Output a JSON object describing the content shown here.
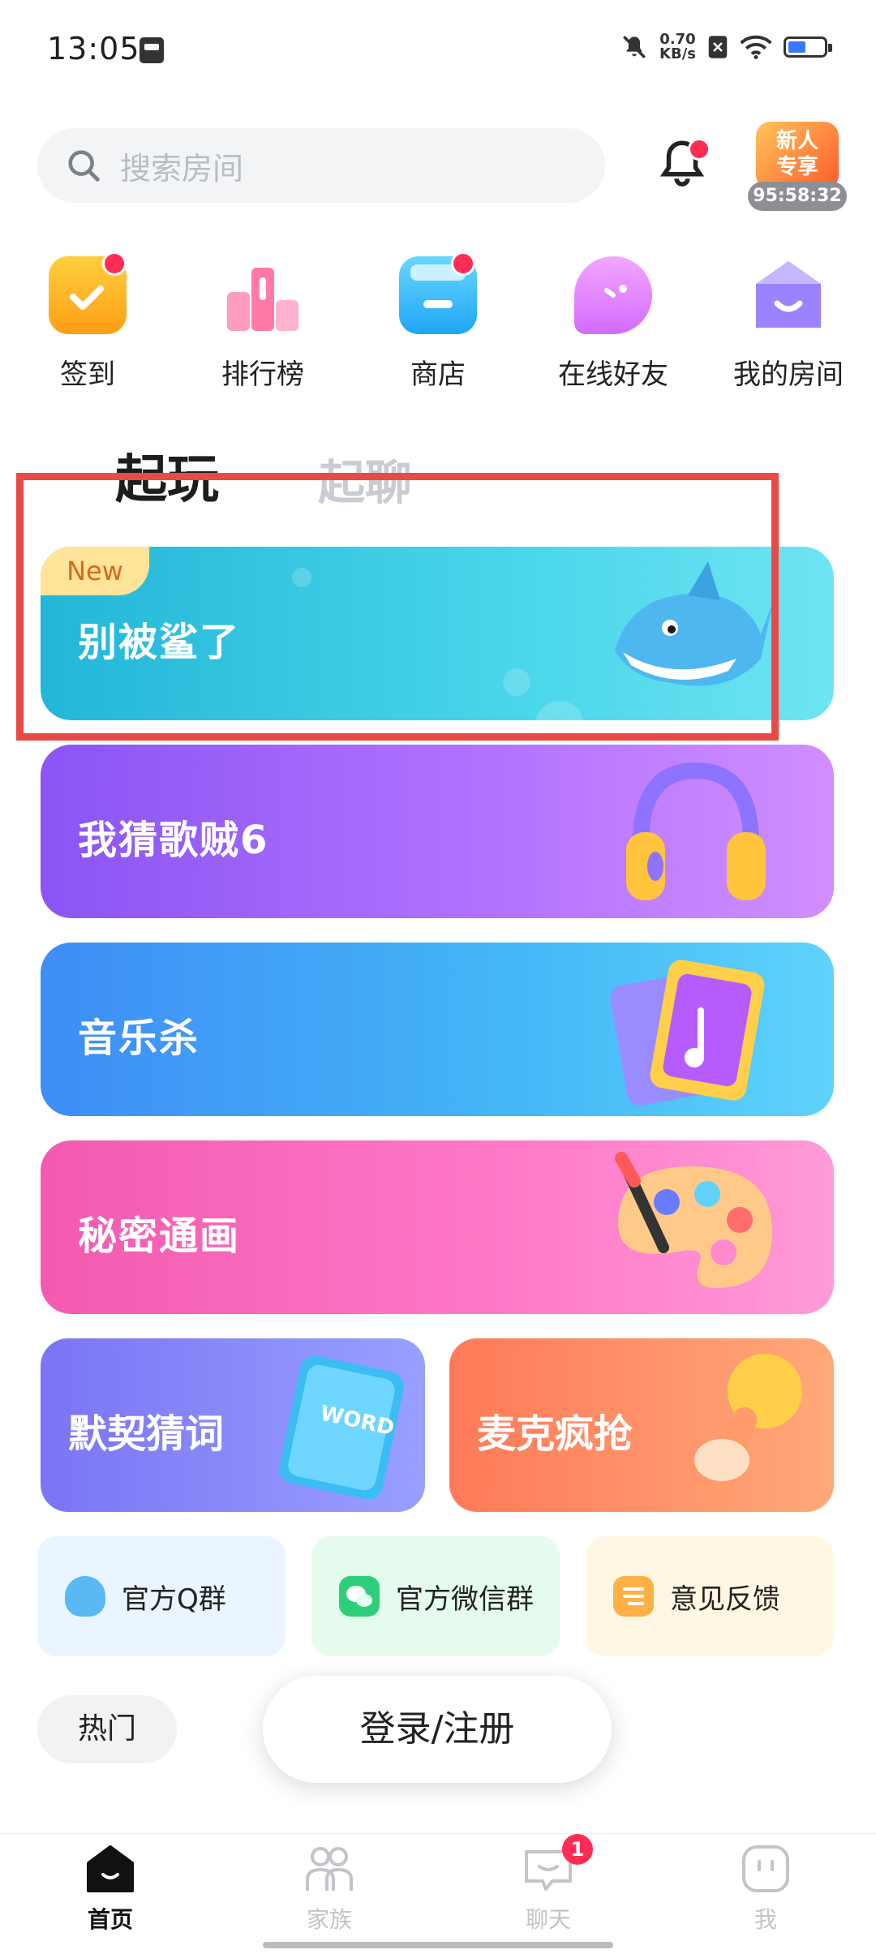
{
  "status": {
    "time": "13:05",
    "net_speed_value": "0.70",
    "net_speed_unit": "KB/s",
    "battery_level": 0.5
  },
  "search": {
    "placeholder": "搜索房间"
  },
  "promo": {
    "label_line1": "新人",
    "label_line2": "专享",
    "timer": "95:58:32"
  },
  "quick_entries": [
    {
      "label": "签到",
      "icon": "calendar-check-icon",
      "color": "#ffb21e",
      "badge": true
    },
    {
      "label": "排行榜",
      "icon": "podium-icon",
      "color": "#ff86b0",
      "badge": false
    },
    {
      "label": "商店",
      "icon": "shop-icon",
      "color": "#3cc4ff",
      "badge": true
    },
    {
      "label": "在线好友",
      "icon": "chat-bubble-icon",
      "color": "#e57bff",
      "badge": false
    },
    {
      "label": "我的房间",
      "icon": "house-icon",
      "color": "#8f74ff",
      "badge": false
    }
  ],
  "tabs": {
    "active": "起玩",
    "inactive": "起聊"
  },
  "games": {
    "shark": {
      "badge": "New",
      "title": "别被鲨了",
      "icon": "shark-icon"
    },
    "guess_song": {
      "title": "我猜歌贼6",
      "icon": "headphones-icon"
    },
    "music_kill": {
      "title": "音乐杀",
      "icon": "music-card-icon"
    },
    "secret_draw": {
      "title": "秘密通画",
      "icon": "palette-icon"
    },
    "guess_word": {
      "title": "默契猜词",
      "icon": "word-book-icon",
      "book_text": "WORD"
    },
    "mic_grab": {
      "title": "麦克疯抢",
      "icon": "microphone-icon"
    }
  },
  "channels": [
    {
      "label": "官方Q群",
      "icon": "qq-icon"
    },
    {
      "label": "官方微信群",
      "icon": "wechat-icon"
    },
    {
      "label": "意见反馈",
      "icon": "feedback-icon"
    }
  ],
  "hot_tab": "热门",
  "login_button": "登录/注册",
  "nav": [
    {
      "label": "首页",
      "icon": "home-icon",
      "active": true
    },
    {
      "label": "家族",
      "icon": "family-icon",
      "active": false
    },
    {
      "label": "聊天",
      "icon": "chat-icon",
      "active": false,
      "badge": "1"
    },
    {
      "label": "我",
      "icon": "profile-icon",
      "active": false
    }
  ]
}
